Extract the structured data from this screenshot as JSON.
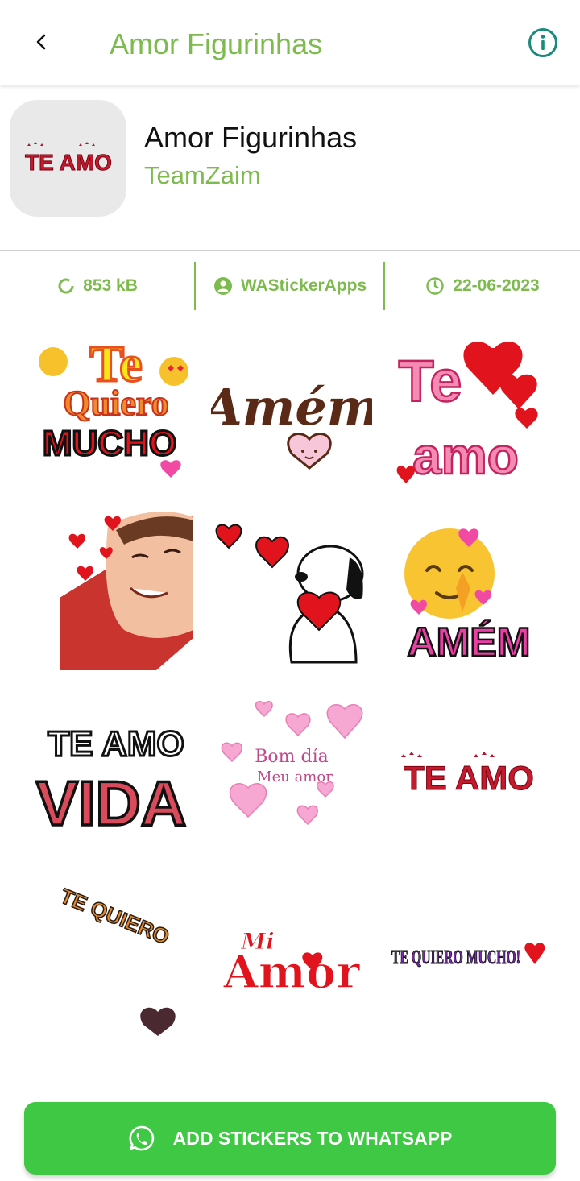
{
  "appbar": {
    "title": "Amor Figurinhas"
  },
  "pack": {
    "name": "Amor Figurinhas",
    "publisher": "TeamZaim",
    "tray_text": "TE AMO"
  },
  "stats": {
    "size": "853 kB",
    "source": "WAStickerApps",
    "date": "22-06-2023"
  },
  "stickers": [
    {
      "name": "te-quiero-mucho",
      "lines": [
        "Te",
        "Quiero",
        "MUCHO"
      ]
    },
    {
      "name": "amem-script",
      "lines": [
        "Amém"
      ]
    },
    {
      "name": "te-amo-pink",
      "lines": [
        "Te",
        "amo"
      ]
    },
    {
      "name": "smiling-child-hearts",
      "lines": []
    },
    {
      "name": "snoopy-heart",
      "lines": []
    },
    {
      "name": "amem-emoji",
      "lines": [
        "AMÉM"
      ]
    },
    {
      "name": "te-amo-vida",
      "lines": [
        "TE AMO",
        "VIDA"
      ]
    },
    {
      "name": "bom-dia-meu-amor",
      "lines": [
        "Bom día",
        "Meu amor"
      ]
    },
    {
      "name": "te-amo-red",
      "lines": [
        "TE AMO"
      ]
    },
    {
      "name": "te-quiero-colorful",
      "lines": [
        "TE QUIERO"
      ]
    },
    {
      "name": "mi-amor",
      "lines": [
        "Mi",
        "Amor"
      ]
    },
    {
      "name": "te-quiero-mucho-purple",
      "lines": [
        "TE QUIERO MUCHO!"
      ]
    }
  ],
  "action": {
    "add_label": "ADD STICKERS TO WHATSAPP"
  },
  "colors": {
    "accent": "#7dbb4f",
    "button": "#3fc843",
    "info": "#1a8a7a"
  }
}
